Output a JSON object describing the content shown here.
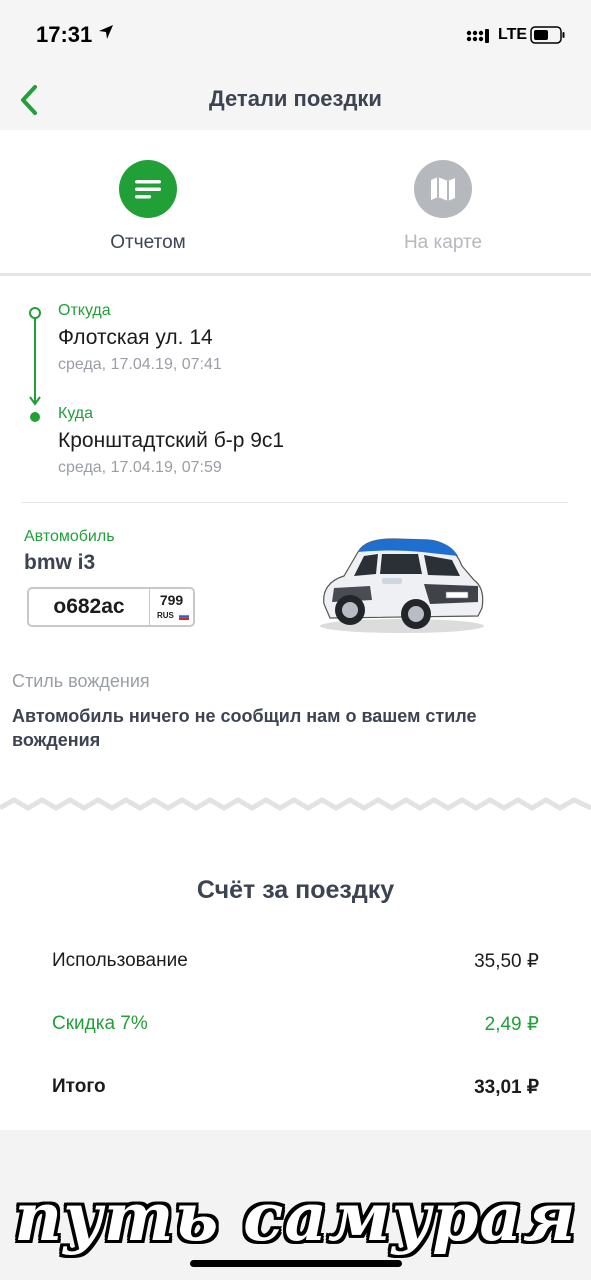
{
  "status_bar": {
    "time": "17:31",
    "network": "LTE"
  },
  "nav": {
    "title": "Детали поездки"
  },
  "tabs": [
    {
      "label": "Отчетом",
      "icon": "list-icon",
      "active": true
    },
    {
      "label": "На карте",
      "icon": "map-icon",
      "active": false
    }
  ],
  "route": {
    "from": {
      "label": "Откуда",
      "address": "Флотская ул. 14",
      "time": "среда, 17.04.19, 07:41"
    },
    "to": {
      "label": "Куда",
      "address": "Кронштадтский б-р 9с1",
      "time": "среда, 17.04.19, 07:59"
    }
  },
  "car": {
    "label": "Автомобиль",
    "model": "bmw i3",
    "plate": {
      "number": "о682ас",
      "region": "799",
      "country": "RUS"
    }
  },
  "driving_style": {
    "label": "Стиль вождения",
    "text": "Автомобиль ничего не сообщил нам о вашем стиле вождения"
  },
  "bill": {
    "title": "Счёт за поездку",
    "rows": [
      {
        "label": "Использование",
        "value": "35,50 ₽"
      },
      {
        "label": "Скидка 7%",
        "value": "2,49 ₽"
      },
      {
        "label": "Итого",
        "value": "33,01 ₽"
      }
    ]
  },
  "watermark": "путь самурая",
  "colors": {
    "accent": "#21a038",
    "title": "#3c4452",
    "muted": "#9a9ea5"
  }
}
